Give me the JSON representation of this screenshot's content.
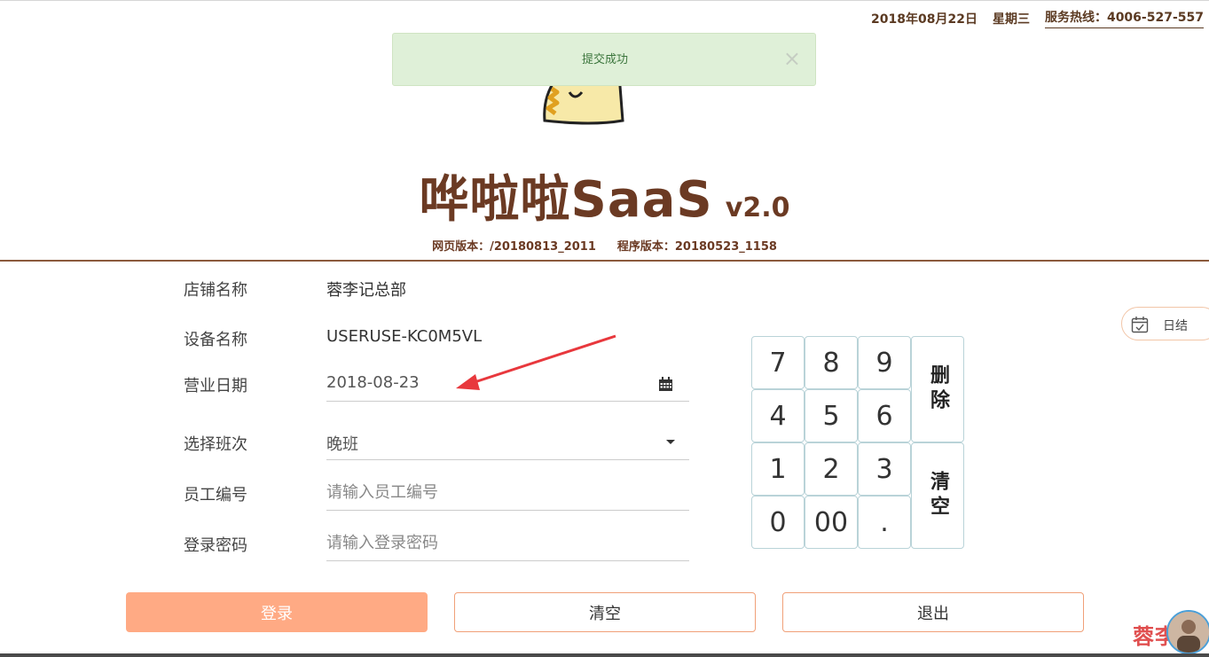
{
  "topbar": {
    "date": "2018年08月22日",
    "weekday": "星期三",
    "hotline": "服务热线：4006-527-557"
  },
  "toast": {
    "message": "提交成功",
    "close": "×"
  },
  "brand": {
    "name": "哗啦啦SaaS",
    "version": "v2.0",
    "web_version": "网页版本：/20180813_2011",
    "program_version": "程序版本：20180523_1158"
  },
  "form": {
    "shop_label": "店铺名称",
    "shop_value": "蓉李记总部",
    "device_label": "设备名称",
    "device_value": "USERUSE-KC0M5VL",
    "date_label": "营业日期",
    "date_value": "2018-08-23",
    "shift_label": "选择班次",
    "shift_value": "晚班",
    "employee_label": "员工编号",
    "employee_placeholder": "请输入员工编号",
    "password_label": "登录密码",
    "password_placeholder": "请输入登录密码"
  },
  "keypad": {
    "k7": "7",
    "k8": "8",
    "k9": "9",
    "k4": "4",
    "k5": "5",
    "k6": "6",
    "k1": "1",
    "k2": "2",
    "k3": "3",
    "k0": "0",
    "k00": "00",
    "kdot": ".",
    "delete": "删除",
    "clear": "清空"
  },
  "buttons": {
    "login": "登录",
    "clear": "清空",
    "exit": "退出"
  },
  "side": {
    "daily_label": "日结"
  },
  "watermark": "蓉李记",
  "icons": {
    "calendar": "calendar-icon",
    "dropdown": "chevron-down-icon",
    "daily": "calendar-check-icon",
    "close": "close-icon"
  },
  "colors": {
    "brand": "#6b3a23",
    "login_button": "#ffaa84",
    "button_border": "#f0a078",
    "toast_bg": "#dff0d8",
    "toast_text": "#3c763d",
    "annotation_arrow": "#e8383d"
  }
}
